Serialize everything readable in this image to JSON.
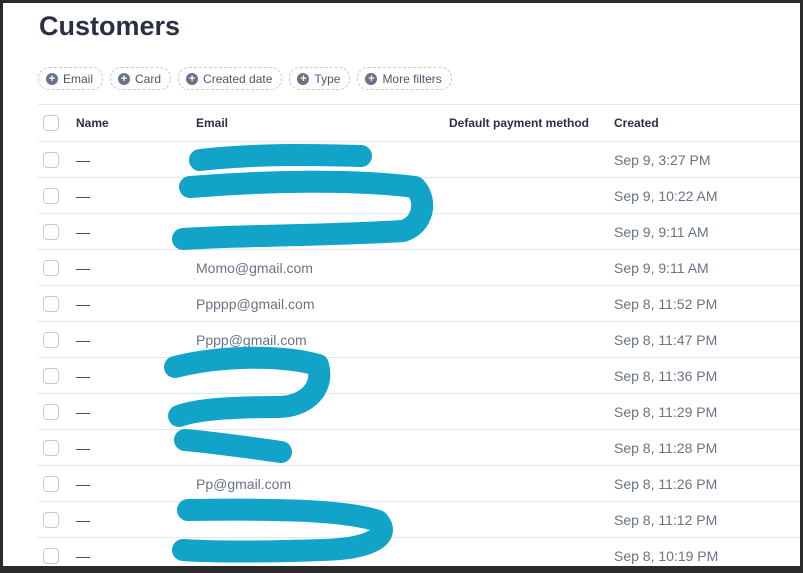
{
  "header": {
    "title": "Customers"
  },
  "filters": [
    "Email",
    "Card",
    "Created date",
    "Type",
    "More filters"
  ],
  "table": {
    "columns": {
      "name": "Name",
      "email": "Email",
      "payment": "Default payment method",
      "created": "Created"
    },
    "rows": [
      {
        "name": "—",
        "email": "",
        "payment": "",
        "created": "Sep 9, 3:27 PM"
      },
      {
        "name": "—",
        "email": "",
        "payment": "",
        "created": "Sep 9, 10:22 AM"
      },
      {
        "name": "—",
        "email": "",
        "payment": "",
        "created": "Sep 9, 9:11 AM"
      },
      {
        "name": "—",
        "email": "Momo@gmail.com",
        "payment": "",
        "created": "Sep 9, 9:11 AM"
      },
      {
        "name": "—",
        "email": "Ppppp@gmail.com",
        "payment": "",
        "created": "Sep 8, 11:52 PM"
      },
      {
        "name": "—",
        "email": "Pppp@gmail.com",
        "payment": "",
        "created": "Sep 8, 11:47 PM"
      },
      {
        "name": "—",
        "email": "",
        "payment": "",
        "created": "Sep 8, 11:36 PM"
      },
      {
        "name": "—",
        "email": "",
        "payment": "",
        "created": "Sep 8, 11:29 PM"
      },
      {
        "name": "—",
        "email": "",
        "payment": "",
        "created": "Sep 8, 11:28 PM"
      },
      {
        "name": "—",
        "email": "Pp@gmail.com",
        "payment": "",
        "created": "Sep 8, 11:26 PM"
      },
      {
        "name": "—",
        "email": "",
        "payment": "",
        "created": "Sep 8, 11:12 PM"
      },
      {
        "name": "—",
        "email": "",
        "payment": "",
        "created": "Sep 8, 10:19 PM"
      }
    ]
  },
  "colors": {
    "redaction": "#11a4c8",
    "title": "#2a2f45",
    "muted": "#697386"
  },
  "icons": {
    "filter_chip": "plus-circle-icon"
  }
}
